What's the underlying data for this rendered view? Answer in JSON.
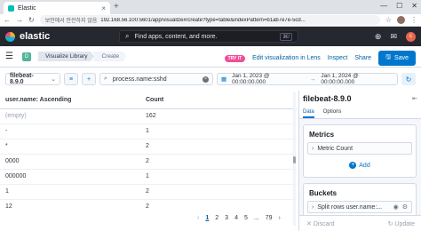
{
  "browser": {
    "tab_title": "Elastic",
    "url_warning": "보안에서 안전하지 않음",
    "url": "192.168.56.100:5601/app/visualize#/create?type=table&indexPattern=b1ab7e7e-5cd..."
  },
  "kibana_header": {
    "brand": "elastic",
    "search_placeholder": "Find apps, content, and more.",
    "search_shortcut": "⌘/",
    "avatar_initial": "c"
  },
  "appbar": {
    "space_initial": "D",
    "breadcrumbs": [
      "Visualize Library",
      "Create"
    ],
    "tryit_label": "TRY IT",
    "lens_link": "Edit visualization in Lens",
    "inspect_link": "Inspect",
    "share_link": "Share",
    "save_label": "Save"
  },
  "querybar": {
    "data_view": "filebeat-8.9.0",
    "query": "process.name:sshd",
    "date_start": "Jan 1, 2023 @ 00:00:00.000",
    "date_end": "Jan 1, 2024 @ 00:00:00.000"
  },
  "table": {
    "columns": [
      "user.name: Ascending",
      "Count"
    ],
    "rows": [
      [
        "(empty)",
        "162"
      ],
      [
        "-",
        "1"
      ],
      [
        "*",
        "2"
      ],
      [
        "0000",
        "2"
      ],
      [
        "000000",
        "1"
      ],
      [
        "1",
        "2"
      ],
      [
        "12",
        "2"
      ]
    ]
  },
  "pagination": {
    "pages": [
      "1",
      "2",
      "3",
      "4",
      "5",
      "...",
      "79"
    ],
    "active_page": "1"
  },
  "side_panel": {
    "title": "filebeat-8.9.0",
    "tabs": [
      "Data",
      "Options"
    ],
    "active_tab": "Data",
    "metrics_title": "Metrics",
    "metric_item": "Metric Count",
    "add_label": "Add",
    "buckets_title": "Buckets",
    "bucket_item": "Split rows user.name:...",
    "discard_label": "Discard",
    "update_label": "Update"
  },
  "colors": {
    "header_bg": "#25282f",
    "accent": "#0077cc",
    "lens_badge": "#f04e98",
    "space_badge": "#54b399"
  }
}
